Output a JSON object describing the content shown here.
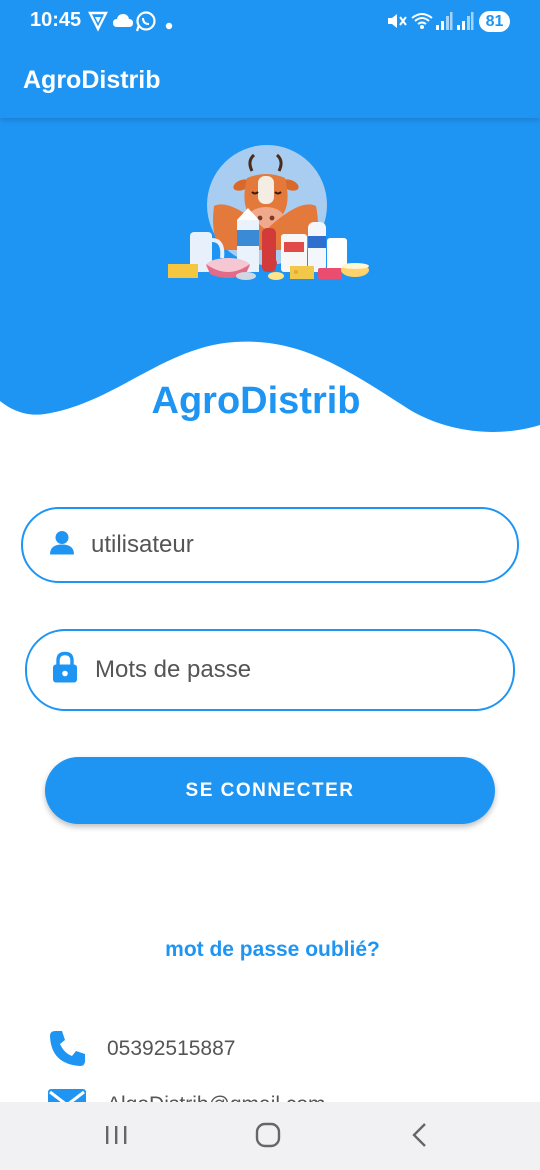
{
  "status_bar": {
    "time": "10:45",
    "battery": "81",
    "icons": [
      "vpn-icon",
      "cloud-icon",
      "whatsapp-icon",
      "dot-icon",
      "mute-icon",
      "wifi-icon",
      "signal-icon",
      "signal-icon"
    ]
  },
  "app_bar": {
    "title": "AgroDistrib"
  },
  "hero": {
    "illustration": "dairy-products-with-cow-illustration"
  },
  "brand": {
    "name": "AgroDistrib"
  },
  "login_form": {
    "username": {
      "placeholder": "utilisateur",
      "value": "",
      "icon": "person-icon"
    },
    "password": {
      "placeholder": "Mots de passe",
      "value": "",
      "icon": "lock-icon"
    },
    "submit_label": "SE CONNECTER",
    "forgot_label": "mot de passe oublié?"
  },
  "contact": {
    "phone": "05392515887",
    "phone_icon": "phone-icon",
    "email": "AlgoDistrib@gmail.com",
    "email_icon": "mail-icon"
  },
  "nav_bar": {
    "buttons": [
      "recent-apps",
      "home",
      "back"
    ]
  },
  "colors": {
    "primary": "#1f95f3",
    "background": "#ffffff",
    "nav_background": "#f1f1f3"
  }
}
